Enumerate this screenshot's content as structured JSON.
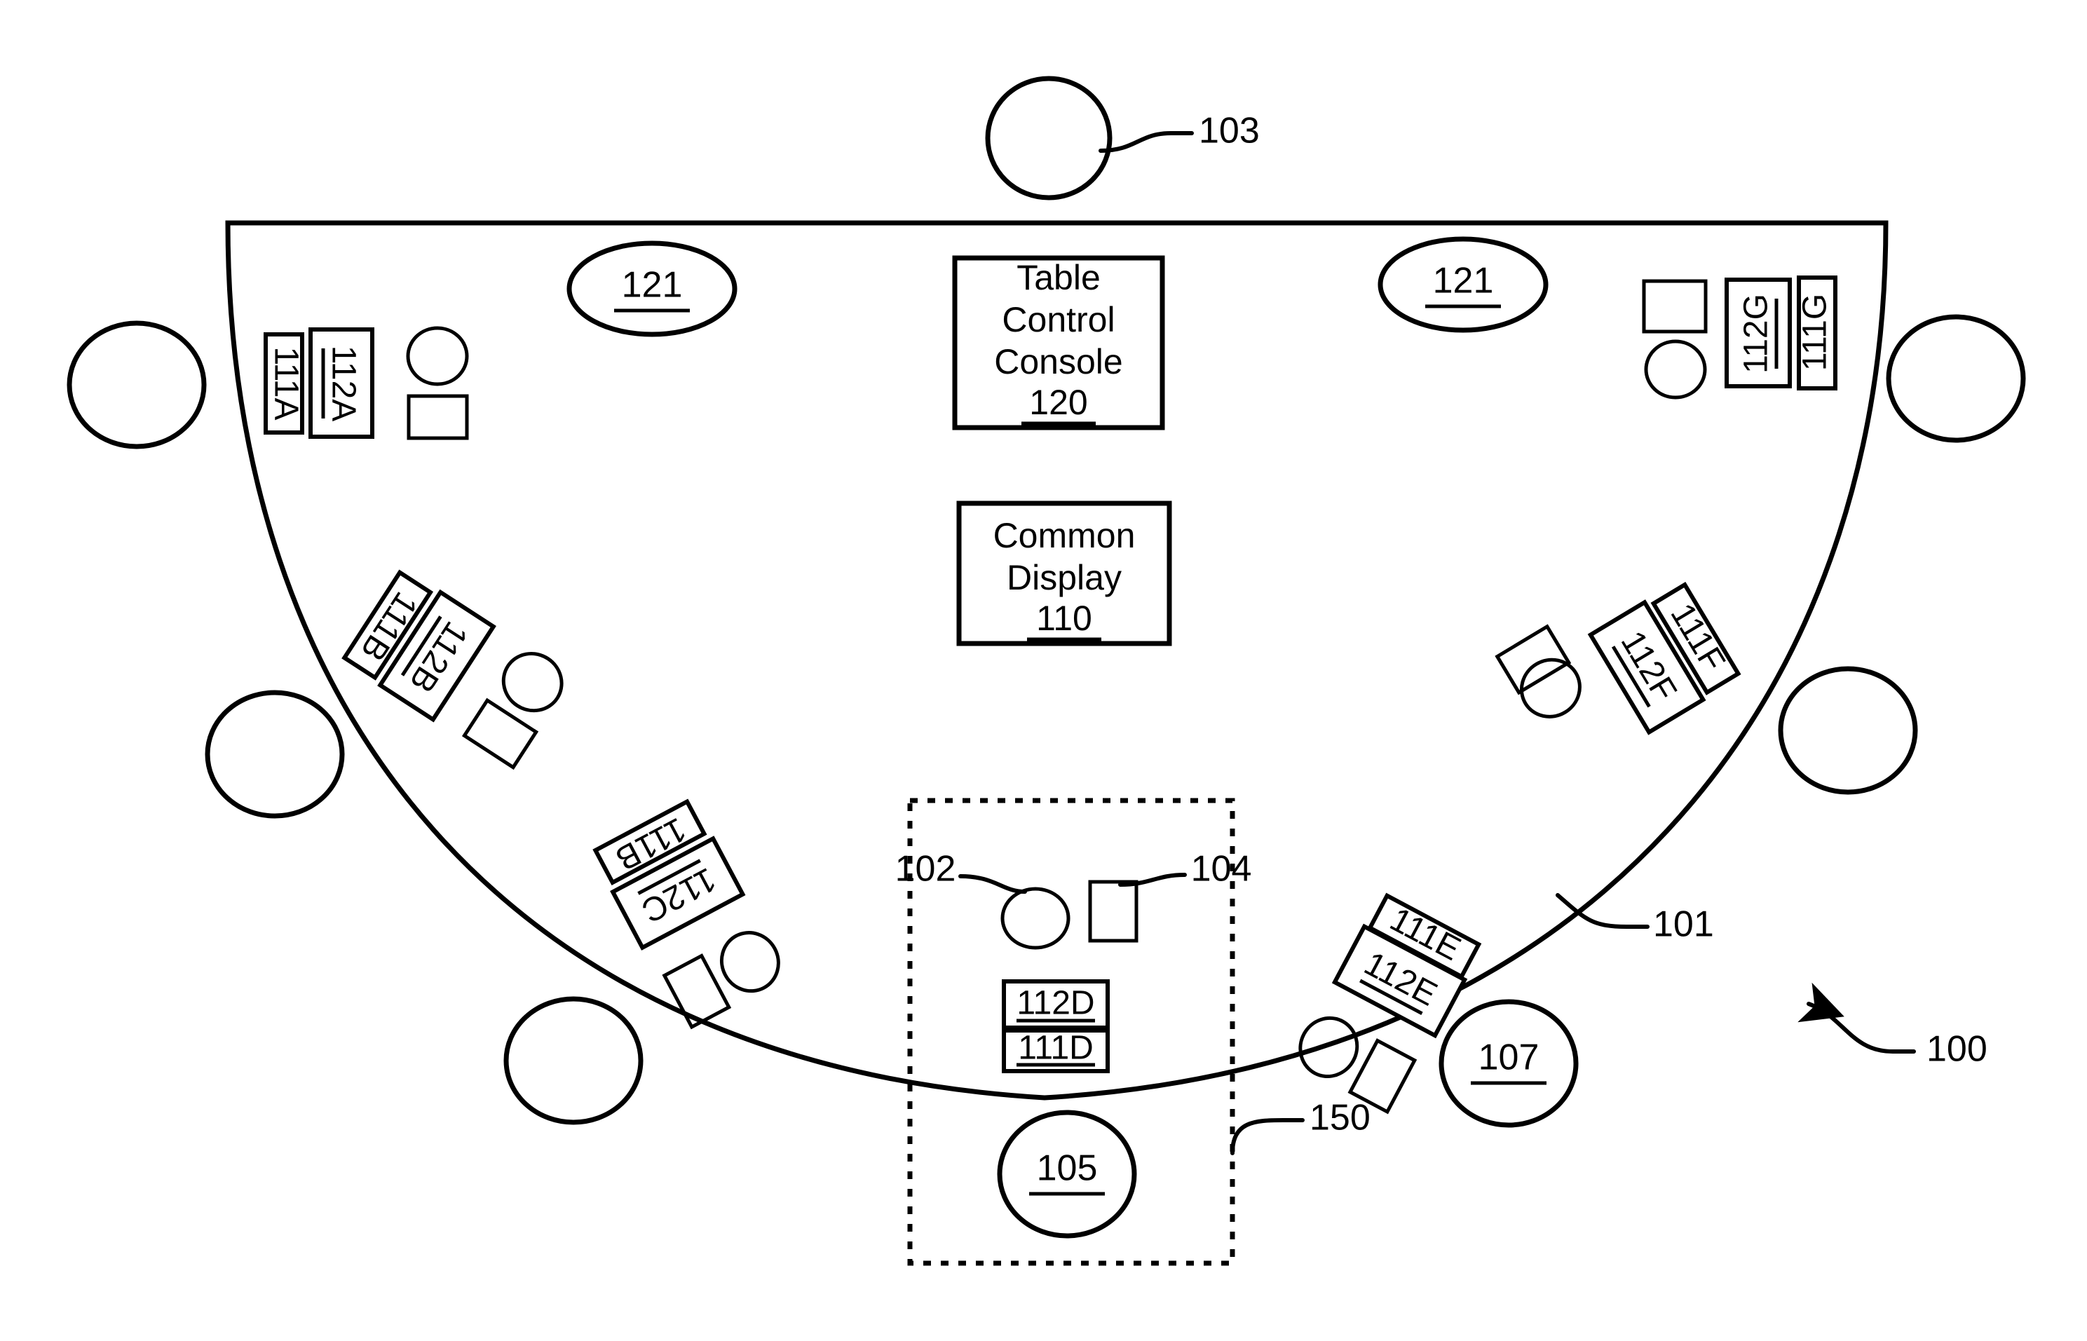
{
  "figure": {
    "title": "Gaming Table System Layout",
    "reference_numerals": {
      "system": "100",
      "table_surface": "101",
      "dealer_position": "103",
      "player_position_circle": "107",
      "chip_tray_region": "150",
      "station_circle": "102",
      "station_square": "104",
      "station_oval": "105"
    }
  },
  "central_modules": [
    {
      "id": "table-control-console",
      "lines": [
        "Table",
        "Control",
        "Console"
      ],
      "numeral": "120"
    },
    {
      "id": "common-display",
      "lines": [
        "Common",
        "Display"
      ],
      "numeral": "110"
    }
  ],
  "overhead_markers": [
    {
      "id": "overhead-left",
      "numeral": "121"
    },
    {
      "id": "overhead-right",
      "numeral": "121"
    }
  ],
  "player_stations": [
    {
      "id": "station-a",
      "display_label": "112A",
      "sensor_label": "111A"
    },
    {
      "id": "station-b",
      "display_label": "112B",
      "sensor_label": "111B"
    },
    {
      "id": "station-c",
      "display_label": "112C",
      "sensor_label": "111B"
    },
    {
      "id": "station-d",
      "display_label": "112D",
      "sensor_label": "111D"
    },
    {
      "id": "station-e",
      "display_label": "112E",
      "sensor_label": "111E"
    },
    {
      "id": "station-f",
      "display_label": "112F",
      "sensor_label": "111F"
    },
    {
      "id": "station-g",
      "display_label": "112G",
      "sensor_label": "111G"
    }
  ],
  "leader_labels": [
    {
      "id": "leader-103",
      "text": "103"
    },
    {
      "id": "leader-101",
      "text": "101"
    },
    {
      "id": "leader-100",
      "text": "100"
    },
    {
      "id": "leader-150",
      "text": "150"
    },
    {
      "id": "leader-102",
      "text": "102"
    },
    {
      "id": "leader-104",
      "text": "104"
    }
  ],
  "circled_numerals": [
    {
      "id": "circled-107",
      "text": "107"
    },
    {
      "id": "circled-105",
      "text": "105"
    }
  ],
  "colors": {
    "ink": "#000000",
    "paper": "#ffffff"
  }
}
